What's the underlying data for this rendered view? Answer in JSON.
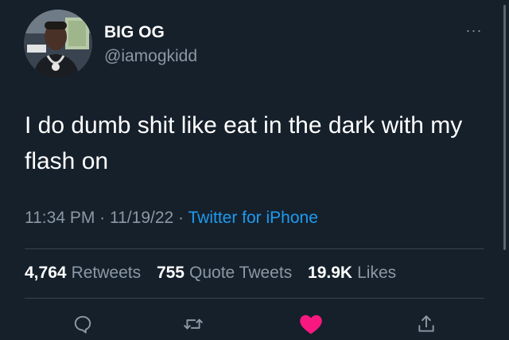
{
  "author": {
    "display_name": "BIG OG",
    "handle": "@iamogkidd"
  },
  "tweet": {
    "text": "I do dumb shit like eat in the dark with my flash on",
    "time": "11:34 PM",
    "date": "11/19/22",
    "separator": "·",
    "source": "Twitter for iPhone"
  },
  "stats": {
    "retweets_count": "4,764",
    "retweets_label": "Retweets",
    "quotes_count": "755",
    "quotes_label": "Quote Tweets",
    "likes_count": "19.9K",
    "likes_label": "Likes"
  },
  "menu": {
    "more_glyph": "···"
  },
  "actions": {
    "reply_icon": "comment-bubble-icon",
    "retweet_icon": "retweet-arrows-icon",
    "like_icon": "heart-filled-icon",
    "share_icon": "share-upload-icon"
  },
  "colors": {
    "background": "#15202b",
    "text_primary": "#ffffff",
    "text_secondary": "#8b98a5",
    "link": "#1d9bf0",
    "like": "#f91880",
    "divider": "#38444d"
  }
}
